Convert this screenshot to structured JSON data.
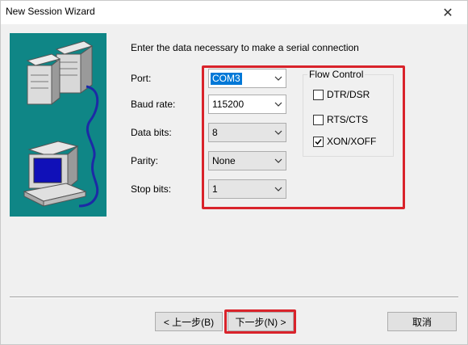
{
  "window": {
    "title": "New Session Wizard",
    "close_glyph": "✕"
  },
  "illustration": {
    "icon": "computer-network-icon",
    "background": "#0f8686"
  },
  "instructions": "Enter the data necessary to make a serial connection",
  "fields": {
    "port": {
      "label": "Port:",
      "value": "COM3"
    },
    "baud": {
      "label": "Baud rate:",
      "value": "115200"
    },
    "data_bits": {
      "label": "Data bits:",
      "value": "8"
    },
    "parity": {
      "label": "Parity:",
      "value": "None"
    },
    "stop_bits": {
      "label": "Stop bits:",
      "value": "1"
    }
  },
  "flow_control": {
    "title": "Flow Control",
    "options": [
      {
        "label": "DTR/DSR",
        "checked": false
      },
      {
        "label": "RTS/CTS",
        "checked": false
      },
      {
        "label": "XON/XOFF",
        "checked": true
      }
    ]
  },
  "buttons": {
    "back": "< 上一步(B)",
    "next": "下一步(N) >",
    "cancel": "取消"
  },
  "colors": {
    "highlight_frame": "#d9232b",
    "selection": "#0078d7"
  }
}
